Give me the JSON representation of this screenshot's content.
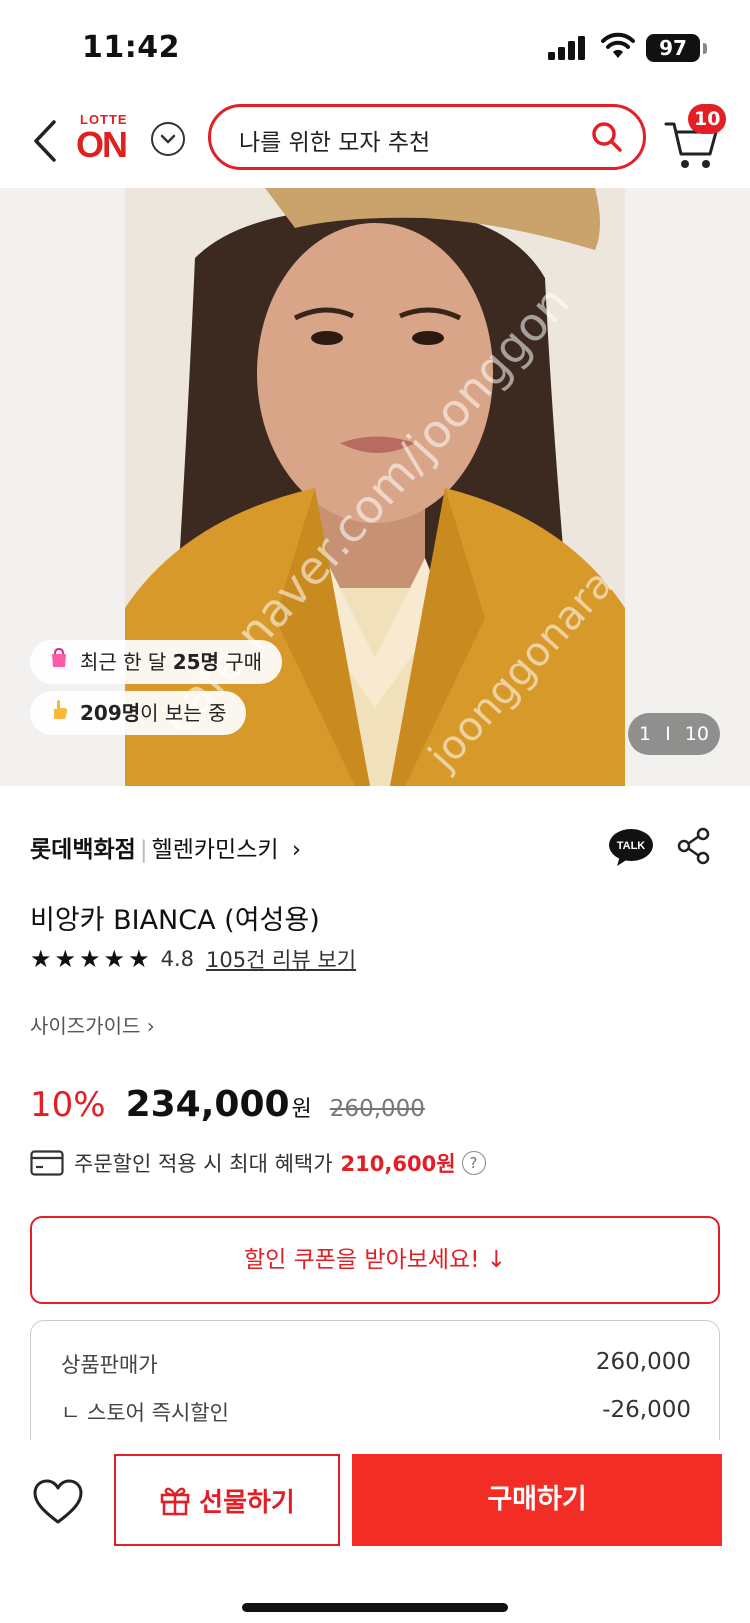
{
  "status_bar": {
    "time": "11:42",
    "battery": "97"
  },
  "header": {
    "logo_top": "LOTTE",
    "logo_bottom": "ON",
    "search_placeholder": "나를 위한 모자 추천",
    "cart_count": "10",
    "icons": [
      "back-arrow-icon",
      "chevron-down-icon",
      "search-icon",
      "cart-icon"
    ]
  },
  "hero": {
    "watermark_1": "cafe.naver.com/joonggon",
    "watermark_2": "joonggonara",
    "badge_recent": {
      "prefix": "최근 한 달 ",
      "count": "25명",
      "suffix": " 구매"
    },
    "badge_viewing": {
      "count": "209명",
      "suffix": "이 보는 중"
    },
    "pager": {
      "current": "1",
      "separator": "I",
      "total": "10"
    }
  },
  "product": {
    "store": "롯데백화점",
    "brand": "헬렌카민스키",
    "brand_chevron": "›",
    "talk_label": "TALK",
    "title": "비앙카 BIANCA (여성용)",
    "rating_stars": "★★★★★",
    "rating_value": "4.8",
    "review_link": "105건 리뷰 보기",
    "size_guide": "사이즈가이드 ›"
  },
  "price": {
    "discount": "10%",
    "sale_price": "234,000",
    "currency": "원",
    "original_price": "260,000",
    "benefit_text": "주문할인 적용 시 최대 혜택가",
    "benefit_amount": "210,600원",
    "help_icon": "?"
  },
  "coupon": {
    "label": "할인 쿠폰을 받아보세요! ↓"
  },
  "price_box": {
    "rows": [
      {
        "label": "상품판매가",
        "value": "260,000"
      },
      {
        "label": "ㄴ 스토어 즉시할인",
        "value": "-26,000"
      }
    ]
  },
  "bottom_bar": {
    "gift_label": "선물하기",
    "buy_label": "구매하기"
  },
  "colors": {
    "accent": "#e31e24",
    "buy_button": "#f22d26"
  }
}
